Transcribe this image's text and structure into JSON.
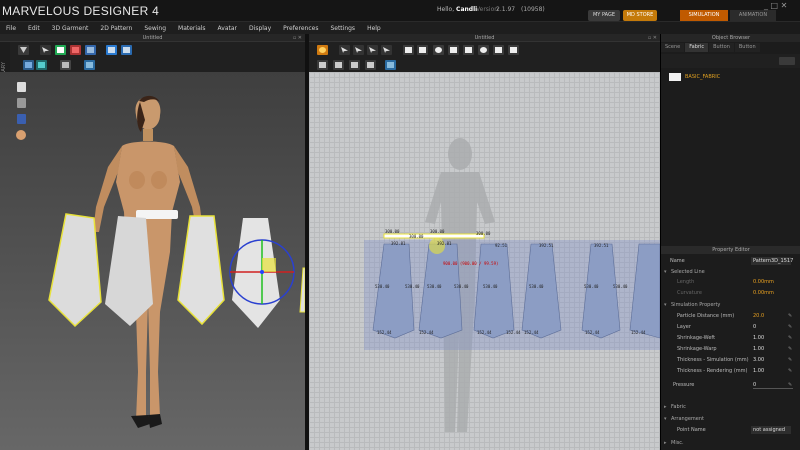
{
  "app": {
    "title": "MARVELOUS DESIGNER 4",
    "greeting": "Hello,",
    "user": "Candli",
    "version_label": "Version",
    "version": "2.1.97",
    "build": "(10958)",
    "my_page": "MY PAGE",
    "md_store": "MD STORE",
    "mode_simulation": "SIMULATION",
    "mode_animation": "ANIMATION",
    "window_controls": "_ □ ✕"
  },
  "menu": [
    "File",
    "Edit",
    "3D Garment",
    "2D Pattern",
    "Sewing",
    "Materials",
    "Avatar",
    "Display",
    "Preferences",
    "Settings",
    "Help"
  ],
  "panels": {
    "view3d_title": "Untitled",
    "view2d_title": "Untitled",
    "object_browser": "Object Browser",
    "property_editor": "Property Editor",
    "library_label": "LIBRARY"
  },
  "object_browser": {
    "tabs": [
      "Scene",
      "Fabric",
      "Button",
      "Button"
    ],
    "active_tab": 1,
    "fabric_name": "BASIC_FABRIC"
  },
  "pattern_measures": {
    "top": [
      "300.00",
      "300.00",
      "300.00",
      "300.00"
    ],
    "top_small": [
      "392.81",
      "392.81",
      "92.51",
      "392.51",
      "392.51"
    ],
    "red": "900.00 (900.00 / 99.59)",
    "mid": [
      "530.40",
      "530.40",
      "530.40",
      "530.40",
      "530.40",
      "530.40",
      "530.40",
      "530.40"
    ],
    "bottom": [
      "152.44",
      "152.44",
      "152.44",
      "152.44",
      "152.44",
      "152.44",
      "152.44"
    ]
  },
  "property_editor": {
    "name_label": "Name",
    "name_value": "Pattern3D_1517",
    "selected_line": "Selected Line",
    "sel_row1_label": "Length",
    "sel_row1_value": "0.00mm",
    "sel_row2_label": "Curvature",
    "sel_row2_value": "0.00mm",
    "simulation_property": "Simulation Property",
    "rows": [
      {
        "label": "Particle Distance (mm)",
        "value": "20.0"
      },
      {
        "label": "Layer",
        "value": "0"
      },
      {
        "label": "Shrinkage-Weft",
        "value": "1.00"
      },
      {
        "label": "Shrinkage-Warp",
        "value": "1.00"
      },
      {
        "label": "Thickness - Simulation (mm)",
        "value": "3.00"
      },
      {
        "label": "Thickness - Rendering (mm)",
        "value": "1.00"
      }
    ],
    "pressure_label": "Pressure",
    "pressure_value": "0",
    "fabric": "Fabric",
    "arrangement": "Arrangement",
    "point_name_label": "Point Name",
    "point_name_value": "not assigned",
    "misc": "Misc."
  },
  "colors": {
    "accent_orange": "#e8a020",
    "store_orange": "#c47a0a",
    "pattern_fill": "#8c9dc4",
    "selection_yellow": "#e8e23a"
  }
}
